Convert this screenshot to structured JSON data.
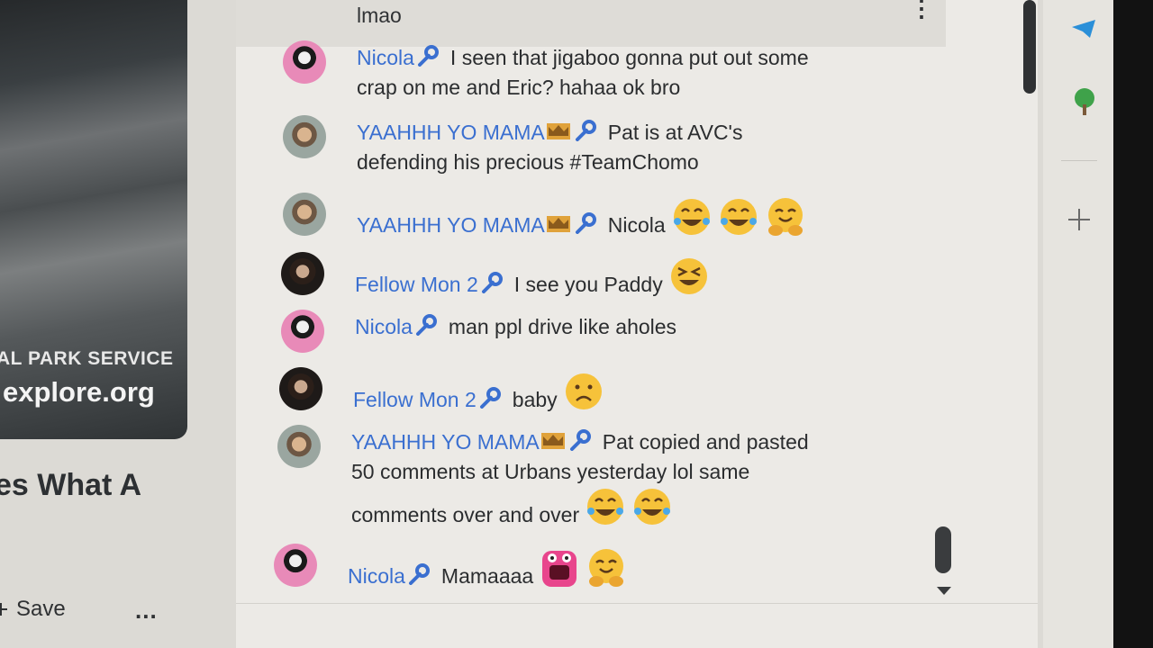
{
  "video": {
    "org_line": "AL PARK SERVICE",
    "site": "explore.org",
    "title_fragment": "es What A",
    "save_label": "Save",
    "more_label": "..."
  },
  "chat": {
    "top_partial_message": "lmao",
    "messages": [
      {
        "author": "Nicola",
        "avatar": "nicola-avatar",
        "badges": [
          "wrench-icon"
        ],
        "lines": [
          "I seen that jigaboo gonna put out some",
          "crap on me and Eric? hahaa ok bro"
        ],
        "emojis": []
      },
      {
        "author": "YAAHHH YO MAMA",
        "avatar": "yahh-avatar",
        "badges": [
          "crown-icon",
          "wrench-icon"
        ],
        "lines": [
          "Pat is at AVC's",
          "defending his precious #TeamChomo"
        ],
        "emojis": []
      },
      {
        "author": "YAAHHH YO MAMA",
        "avatar": "yahh-avatar",
        "badges": [
          "crown-icon",
          "wrench-icon"
        ],
        "lines": [
          "Nicola"
        ],
        "emojis": [
          "tears-of-joy",
          "tears-of-joy",
          "hug-face"
        ]
      },
      {
        "author": "Fellow Mon 2",
        "avatar": "fellow-avatar",
        "badges": [
          "wrench-icon"
        ],
        "lines": [
          "I see you Paddy"
        ],
        "emojis": [
          "grinning-squint"
        ]
      },
      {
        "author": "Nicola",
        "avatar": "nicola-avatar",
        "badges": [
          "wrench-icon"
        ],
        "lines": [
          "man ppl drive like aholes"
        ],
        "emojis": []
      },
      {
        "author": "Fellow Mon 2",
        "avatar": "fellow-avatar",
        "badges": [
          "wrench-icon"
        ],
        "lines": [
          "baby"
        ],
        "emojis": [
          "frowning-face"
        ]
      },
      {
        "author": "YAAHHH YO MAMA",
        "avatar": "yahh-avatar",
        "badges": [
          "crown-icon",
          "wrench-icon"
        ],
        "lines": [
          "Pat copied and pasted",
          "50 comments at Urbans yesterday lol same",
          "comments over and over"
        ],
        "emojis": [
          "tears-of-joy",
          "tears-of-joy"
        ]
      },
      {
        "author": "Nicola",
        "avatar": "nicola-avatar",
        "badges": [
          "wrench-icon"
        ],
        "lines": [
          "Mamaaaa"
        ],
        "emojis": [
          "pink-monster",
          "hug-face"
        ]
      }
    ]
  },
  "colors": {
    "author": "#3a6fd0",
    "text": "#2b2d2f",
    "chat_bg": "#eceae6"
  }
}
